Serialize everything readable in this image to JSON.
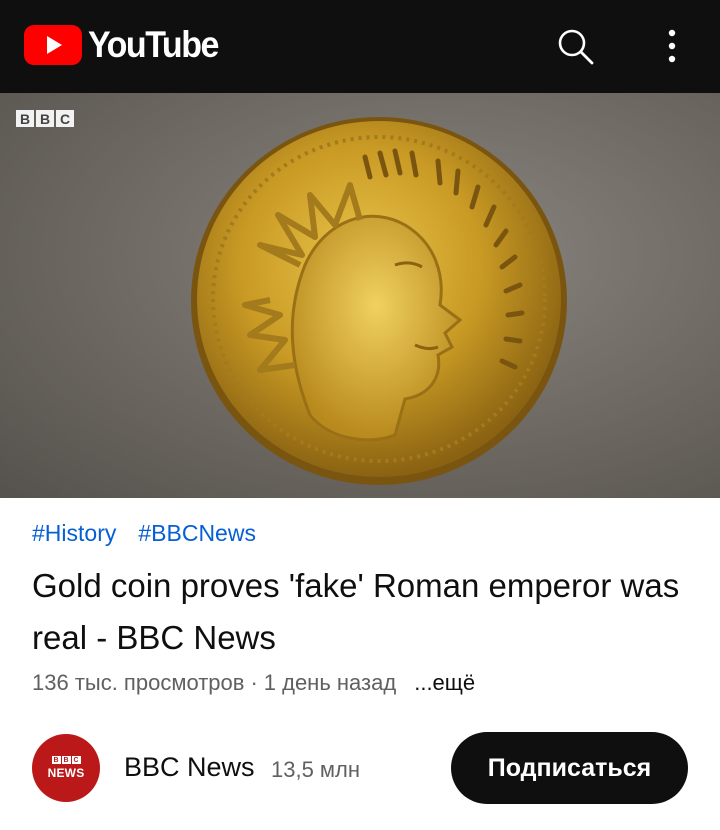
{
  "header": {
    "logo_text": "YouTube",
    "brand_color": "#ff0000",
    "search_icon": "search-icon",
    "menu_icon": "more-vert-icon"
  },
  "video": {
    "watermark": [
      "B",
      "B",
      "C"
    ]
  },
  "hashtags": [
    "#History",
    "#BBCNews"
  ],
  "title": "Gold coin proves 'fake' Roman emperor was real - BBC News",
  "meta": {
    "views": "136 тыс. просмотров",
    "separator": "·",
    "age": "1 день назад",
    "more": "...ещё"
  },
  "channel": {
    "avatar_mark": [
      "B",
      "B",
      "C"
    ],
    "avatar_text": "NEWS",
    "name": "BBC News",
    "subscribers": "13,5 млн",
    "subscribe_label": "Подписаться"
  },
  "colors": {
    "link": "#065fd4",
    "avatar_bg": "#bb1919",
    "header_bg": "#0f0f0f"
  }
}
